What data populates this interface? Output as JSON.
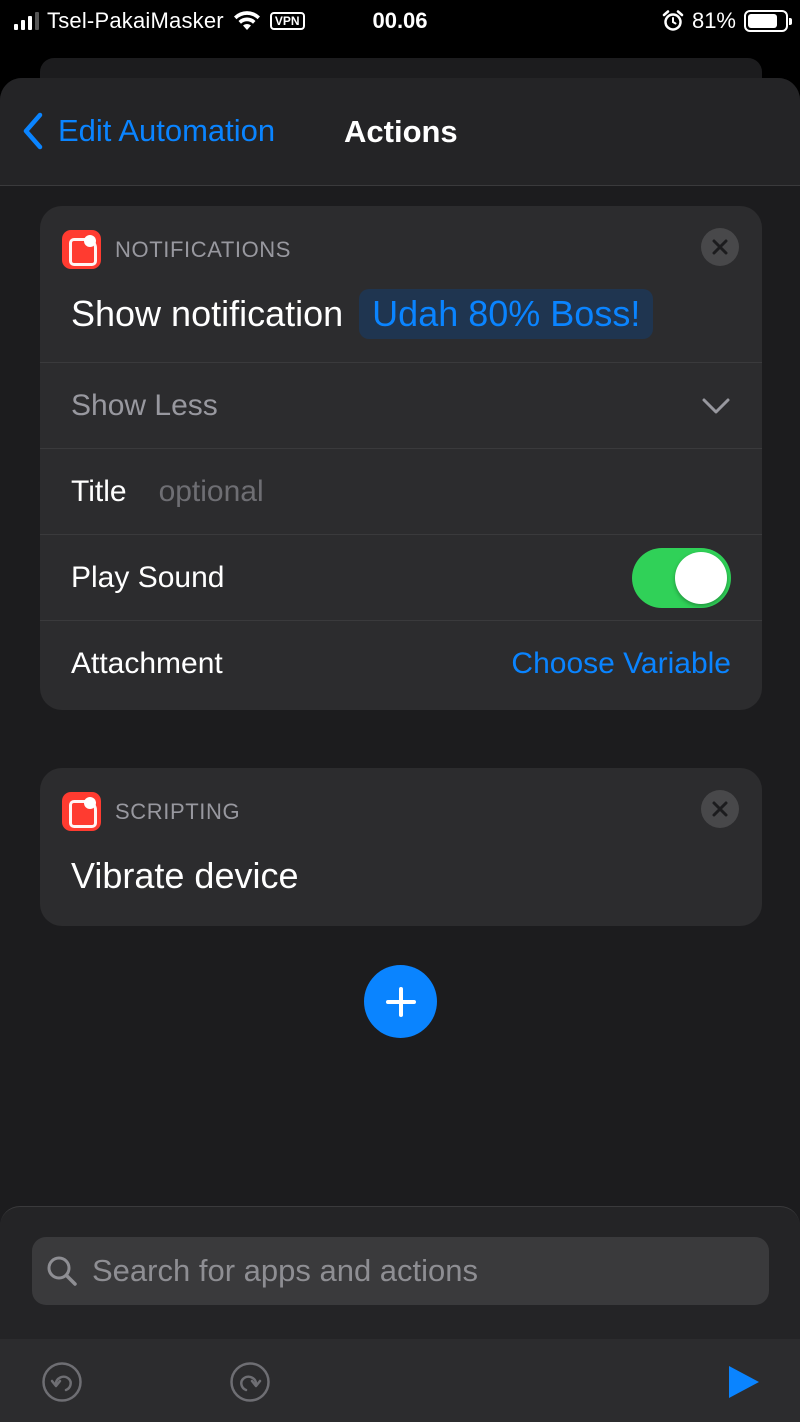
{
  "status_bar": {
    "carrier": "Tsel-PakaiMasker",
    "vpn": "VPN",
    "time": "00.06",
    "battery": "81%",
    "battery_level": 0.81
  },
  "nav": {
    "back_label": "Edit Automation",
    "title": "Actions"
  },
  "actions": [
    {
      "category": "NOTIFICATIONS",
      "action_text": "Show notification",
      "variable": "Udah 80% Boss!",
      "show_less": "Show Less",
      "title_label": "Title",
      "title_placeholder": "optional",
      "play_sound_label": "Play Sound",
      "play_sound_on": true,
      "attachment_label": "Attachment",
      "attachment_value": "Choose Variable"
    },
    {
      "category": "SCRIPTING",
      "action_text": "Vibrate device"
    }
  ],
  "search": {
    "placeholder": "Search for apps and actions"
  },
  "colors": {
    "accent": "#0a84ff",
    "toggle_on": "#30d158",
    "app_icon": "#ff3b30"
  },
  "icons": {
    "back": "chevron-left-icon",
    "close": "close-icon",
    "add": "plus-icon",
    "search": "search-icon",
    "undo": "undo-icon",
    "redo": "redo-icon",
    "run": "play-icon"
  }
}
